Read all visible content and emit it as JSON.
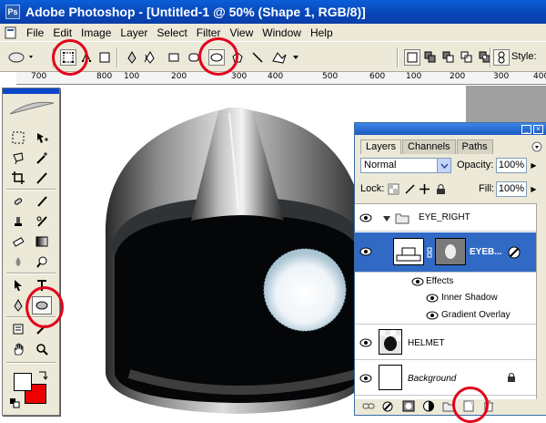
{
  "window": {
    "title": "Adobe Photoshop - [Untitled-1 @ 50% (Shape 1, RGB/8)]"
  },
  "menu": [
    "File",
    "Edit",
    "Image",
    "Layer",
    "Select",
    "Filter",
    "View",
    "Window",
    "Help"
  ],
  "options_bar": {
    "style_label": "Style:"
  },
  "ruler": {
    "labels": [
      "700",
      "800",
      "100",
      "200",
      "300",
      "400",
      "500",
      "600",
      "100",
      "200",
      "300",
      "400"
    ]
  },
  "layers_panel": {
    "tabs": [
      "Layers",
      "Channels",
      "Paths"
    ],
    "blend_mode": "Normal",
    "opacity_label": "Opacity:",
    "opacity_value": "100%",
    "lock_label": "Lock:",
    "fill_label": "Fill:",
    "fill_value": "100%",
    "layers": [
      {
        "name": "EYE_RIGHT",
        "kind": "group"
      },
      {
        "name": "EYEB...",
        "kind": "shape",
        "selected": true
      },
      {
        "name": "Effects",
        "kind": "effects"
      },
      {
        "name": "Inner Shadow",
        "kind": "effect"
      },
      {
        "name": "Gradient Overlay",
        "kind": "effect"
      },
      {
        "name": "HELMET",
        "kind": "layer"
      },
      {
        "name": "Background",
        "kind": "background"
      }
    ]
  },
  "colors": {
    "foreground": "#ffffff",
    "background": "#ee0000",
    "annotation": "#e3001b"
  }
}
